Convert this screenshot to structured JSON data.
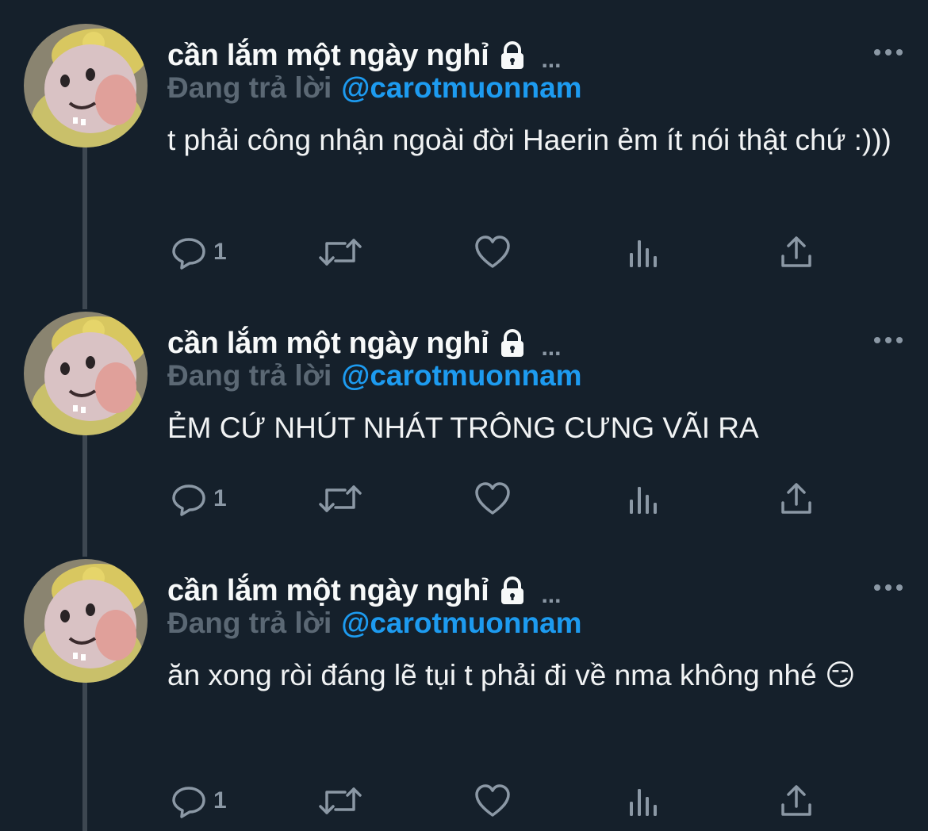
{
  "tweets": [
    {
      "author": "cần lắm một ngày nghỉ",
      "trailing": "...",
      "reply_prefix": "Đang trả lời",
      "reply_handle": "@carotmuonnam",
      "text": "t phải công nhận ngoài đời Haerin ẻm ít nói thật chứ :)))",
      "reply_count": "1"
    },
    {
      "author": "cần lắm một ngày nghỉ",
      "trailing": "...",
      "reply_prefix": "Đang trả lời",
      "reply_handle": "@carotmuonnam",
      "text": "ẺM CỨ NHÚT NHÁT TRÔNG CƯNG VÃI RA",
      "reply_count": "1"
    },
    {
      "author": "cần lắm một ngày nghỉ",
      "trailing": "...",
      "reply_prefix": "Đang trả lời",
      "reply_handle": "@carotmuonnam",
      "text": "ăn xong ròi đáng lẽ tụi t phải đi về nma không nhé 😏",
      "reply_count": "1"
    }
  ],
  "icons": {
    "avatar": "avatar-image",
    "lock": "lock-icon",
    "more": "more-options-icon",
    "reply": "reply-icon",
    "retweet": "retweet-icon",
    "like": "like-icon",
    "views": "views-icon",
    "share": "share-icon"
  },
  "colors": {
    "background": "#15202b",
    "link": "#1d9bf0",
    "muted": "#8b98a5",
    "thread_line": "#3d4751"
  }
}
